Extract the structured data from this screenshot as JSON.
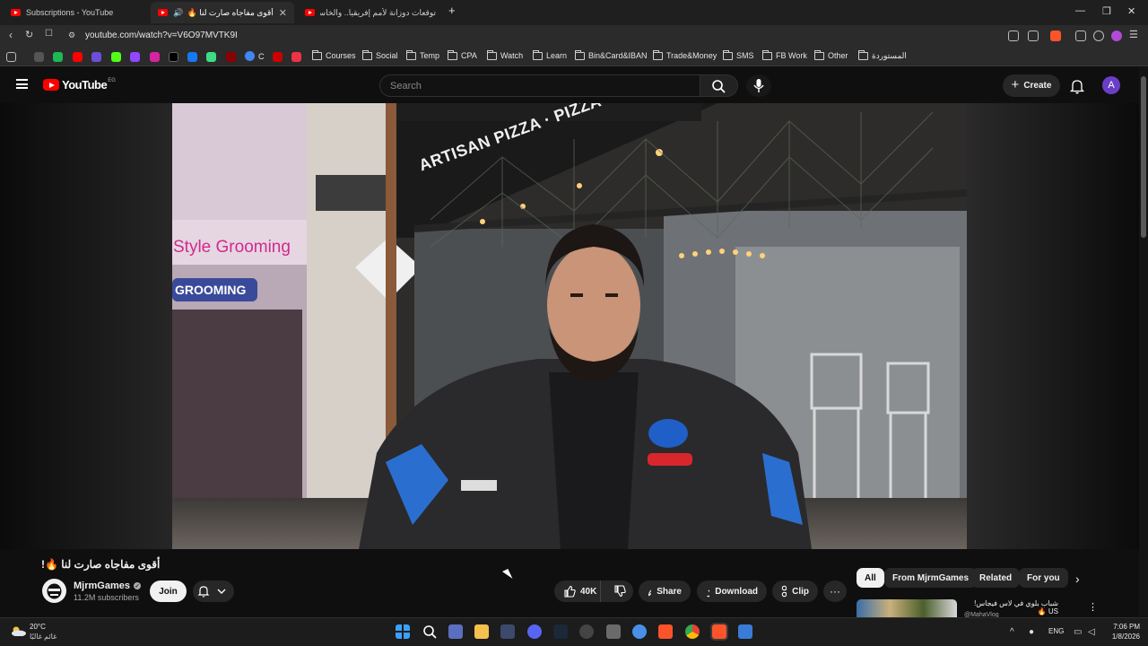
{
  "browser": {
    "tabs": [
      {
        "label": "Subscriptions - YouTube",
        "active": false
      },
      {
        "label": "أقوى مفاجاه صارت لنا 🔥! - e",
        "active": true
      },
      {
        "label": "توقعات دوزانة لأمم إفريقيا.. والخاسر له",
        "active": false
      }
    ],
    "new_tab": "+",
    "url": "youtube.com/watch?v=V6O97MVTK9I",
    "window_controls": {
      "minimize": "—",
      "restore": "❐",
      "close": "✕"
    },
    "bookmark_folders": [
      "Courses",
      "Social",
      "Temp",
      "CPA",
      "Watch",
      "Learn",
      "Bin&Card&IBAN",
      "Trade&Money",
      "SMS",
      "FB Work",
      "Other",
      "المستوردة"
    ],
    "bookmark_c_label": "C"
  },
  "youtube": {
    "logo_text": "YouTube",
    "country_code": "EG",
    "search_placeholder": "Search",
    "create_label": "Create",
    "avatar_letter": "A"
  },
  "video": {
    "title": "أقوى مفاجاه صارت لنا 🔥!",
    "scene_sign_text": "ARTISAN PIZZA · PIZZA CONES ·",
    "storefront_text_1": "Style Grooming",
    "storefront_text_2": "GROOMING",
    "channel_name": "MjrmGames",
    "verified_mark": "✓",
    "subscribers": "11.2M subscribers",
    "join_label": "Join",
    "like_count": "40K",
    "share_label": "Share",
    "download_label": "Download",
    "clip_label": "Clip",
    "more_label": "···"
  },
  "sidebar": {
    "chips": [
      "All",
      "From MjrmGames",
      "Related",
      "For you"
    ],
    "chip_next": "›",
    "recommendation": {
      "title": "شباب بلوي في لاس فيجاس! US 🔥",
      "channel": "@MahaVlog",
      "menu": "⋮"
    }
  },
  "taskbar": {
    "weather_temp": "20°C",
    "weather_cond": "غائم غالبًا",
    "language": "ENG",
    "time": "7:06 PM",
    "date": "1/8/2026",
    "tray_chevron": "^"
  },
  "colors": {
    "yt_red": "#ff0000",
    "bg": "#0f0f0f",
    "chip_bg": "#272727",
    "avatar": "#6b3ec7"
  }
}
